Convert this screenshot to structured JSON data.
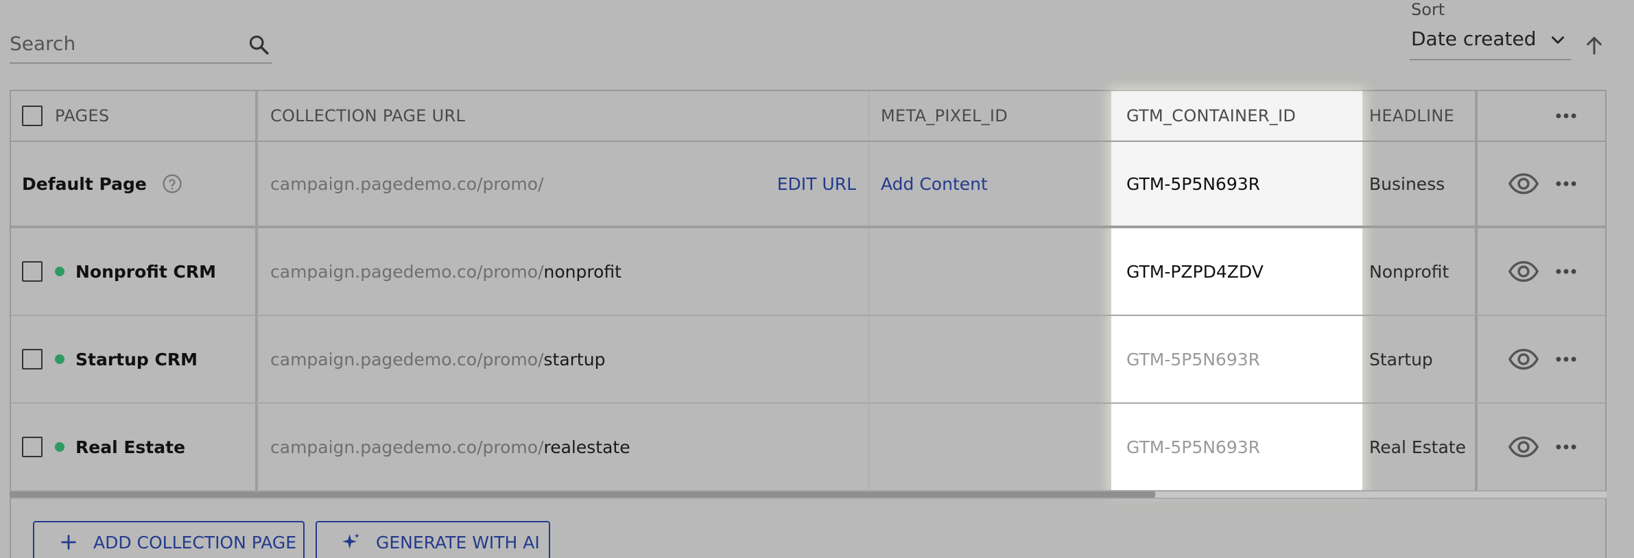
{
  "toolbar": {
    "search_placeholder": "Search",
    "sort_label": "Sort",
    "sort_value": "Date created"
  },
  "table": {
    "columns": [
      "PAGES",
      "COLLECTION PAGE URL",
      "META_PIXEL_ID",
      "GTM_CONTAINER_ID",
      "HEADLINE"
    ],
    "default_row": {
      "name": "Default Page",
      "url_base": "campaign.pagedemo.co/promo/",
      "edit_url": "EDIT URL",
      "meta": "Add Content",
      "gtm": "GTM-5P5N693R",
      "headline": "Business"
    },
    "rows": [
      {
        "name": "Nonprofit CRM",
        "url_base": "campaign.pagedemo.co/promo/",
        "url_slug": "nonprofit",
        "gtm": "GTM-PZPD4ZDV",
        "headline": "Nonprofit",
        "status_color": "#2f9a62"
      },
      {
        "name": "Startup CRM",
        "url_base": "campaign.pagedemo.co/promo/",
        "url_slug": "startup",
        "gtm": "GTM-5P5N693R",
        "headline": "Startup",
        "status_color": "#2f9a62"
      },
      {
        "name": "Real Estate",
        "url_base": "campaign.pagedemo.co/promo/",
        "url_slug": "realestate",
        "gtm": "GTM-5P5N693R",
        "headline": "Real Estate",
        "status_color": "#2f9a62"
      }
    ]
  },
  "actions": {
    "add_collection_page": "ADD COLLECTION PAGE",
    "generate_with_ai": "GENERATE WITH AI"
  },
  "colors": {
    "accent": "#243b8c",
    "status_published": "#2f9a62",
    "overlay_gray": "#b9b9b9",
    "highlight": "#ffffff"
  },
  "icons": [
    "search-icon",
    "chevron-down-icon",
    "arrow-up-icon",
    "help-circle-icon",
    "eye-icon",
    "more-horizontal-icon",
    "plus-icon",
    "sparkle-icon"
  ]
}
